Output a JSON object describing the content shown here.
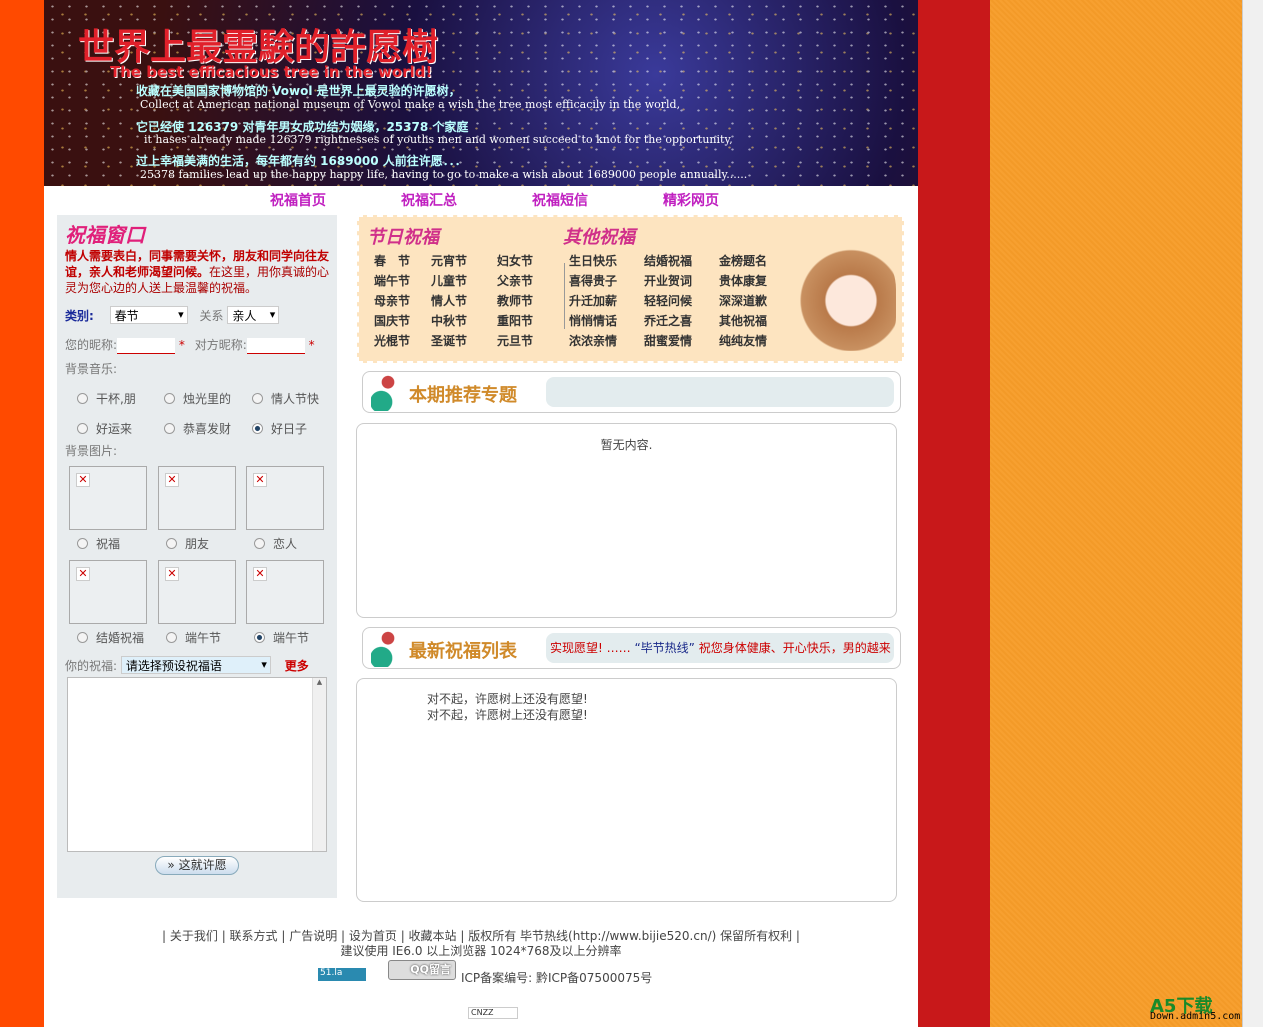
{
  "banner": {
    "title": "世界上最霊験的許愿樹",
    "subtitle": "The best efficacious tree in the world!",
    "lines": [
      "收藏在美国国家博物馆的 Vowol 是世界上最灵验的许愿树，",
      "Collect at American national museum of Vowol make a wish the tree most efficacily in the world,",
      "它已经使 126379 对青年男女成功结为姻缘，25378 个家庭",
      "it hases already made 126379 rightnesses of youths men and women succeed to knot for the opportunity,",
      "过上幸福美满的生活，每年都有约 1689000 人前往许愿．．．",
      "25378 families lead up the happy happy life, having to go to make a wish about 1689000 people annually......"
    ]
  },
  "nav": [
    "祝福首页",
    "祝福汇总",
    "祝福短信",
    "精彩网页"
  ],
  "left": {
    "title": "祝福窗口",
    "intro_bold": "情人需要表白，同事需要关怀，朋友和同学向往友谊，亲人和老师渴望问候。",
    "intro": "在这里，用你真诚的心灵为您心边的人送上最温馨的祝福。",
    "category_label": "类别:",
    "category_value": "春节",
    "relation_label": "关系",
    "relation_value": "亲人",
    "nick_label": "您的昵称:",
    "other_nick_label": "对方昵称:",
    "required": "*",
    "music_label": "背景音乐:",
    "music": [
      {
        "label": "干杯,朋",
        "checked": false
      },
      {
        "label": "烛光里的",
        "checked": false
      },
      {
        "label": "情人节快",
        "checked": false
      },
      {
        "label": "好运来",
        "checked": false
      },
      {
        "label": "恭喜发财",
        "checked": false
      },
      {
        "label": "好日子",
        "checked": true
      }
    ],
    "image_label": "背景图片:",
    "images": [
      {
        "label": "祝福",
        "checked": false
      },
      {
        "label": "朋友",
        "checked": false
      },
      {
        "label": "恋人",
        "checked": false
      },
      {
        "label": "结婚祝福",
        "checked": false
      },
      {
        "label": "端午节",
        "checked": false
      },
      {
        "label": "端午节",
        "checked": true
      }
    ],
    "wish_label": "你的祝福:",
    "wish_select": "请选择预设祝福语",
    "more": "更多",
    "submit": "» 这就许愿"
  },
  "festival": {
    "title": "节日祝福",
    "items": [
      "春　节",
      "元宵节",
      "妇女节",
      "端午节",
      "儿童节",
      "父亲节",
      "母亲节",
      "情人节",
      "教师节",
      "国庆节",
      "中秋节",
      "重阳节",
      "光棍节",
      "圣诞节",
      "元旦节"
    ]
  },
  "other": {
    "title": "其他祝福",
    "items": [
      "生日快乐",
      "结婚祝福",
      "金榜题名",
      "喜得贵子",
      "开业贺词",
      "贵体康复",
      "升迁加薪",
      "轻轻问候",
      "深深道歉",
      "悄悄情话",
      "乔迁之喜",
      "其他祝福",
      "浓浓亲情",
      "甜蜜爱情",
      "纯纯友情"
    ]
  },
  "recommend": {
    "title": "本期推荐专题",
    "empty": "暂无内容."
  },
  "latest": {
    "title": "最新祝福列表",
    "ticker_a": "实现愿望! ……",
    "ticker_b": "“毕节热线”",
    "ticker_c": "祝您身体健康、开心快乐，男的越来",
    "messages": [
      "对不起，许愿树上还没有愿望!",
      "对不起，许愿树上还没有愿望!"
    ]
  },
  "footer": {
    "links": "| 关于我们 | 联系方式 | 广告说明 | 设为首页 | 收藏本站 | 版权所有 毕节热线(http://www.bijie520.cn/) 保留所有权利 |",
    "browser": "建议使用 IE6.0 以上浏览器 1024*768及以上分辨率",
    "badge_51la": "51.la",
    "badge_qq": "QQ留言",
    "icp": "ICP备案编号:  黔ICP备07500075号",
    "cnzz": "CNZZ"
  },
  "watermark": {
    "brand": "A5下载",
    "url": "Down.admin5.com"
  }
}
